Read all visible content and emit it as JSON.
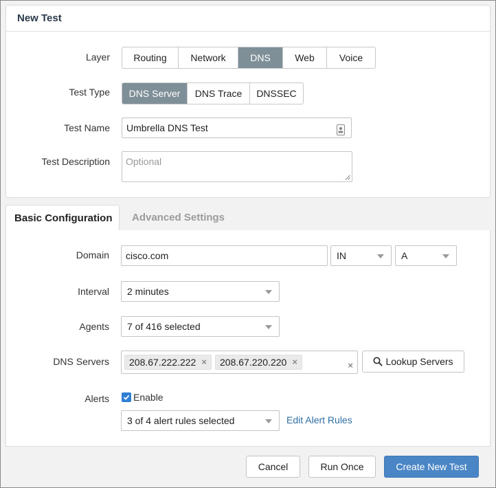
{
  "new_test": {
    "title": "New Test",
    "layer": {
      "label": "Layer",
      "options": [
        "Routing",
        "Network",
        "DNS",
        "Web",
        "Voice"
      ],
      "selected": "DNS"
    },
    "test_type": {
      "label": "Test Type",
      "options": [
        "DNS Server",
        "DNS Trace",
        "DNSSEC"
      ],
      "selected": "DNS Server"
    },
    "test_name": {
      "label": "Test Name",
      "value": "Umbrella DNS Test",
      "icon": "contact-card-icon"
    },
    "test_description": {
      "label": "Test Description",
      "placeholder": "Optional"
    }
  },
  "tabs": {
    "basic": "Basic Configuration",
    "advanced": "Advanced Settings",
    "active": "basic"
  },
  "basic": {
    "domain": {
      "label": "Domain",
      "value": "cisco.com",
      "class_value": "IN",
      "record_value": "A"
    },
    "interval": {
      "label": "Interval",
      "value": "2 minutes"
    },
    "agents": {
      "label": "Agents",
      "value": "7 of 416 selected"
    },
    "dns_servers": {
      "label": "DNS Servers",
      "servers": [
        "208.67.222.222",
        "208.67.220.220"
      ],
      "remove_glyph": "×",
      "clear_glyph": "×",
      "lookup_label": "Lookup Servers",
      "lookup_icon": "search-icon"
    },
    "alerts": {
      "label": "Alerts",
      "enable_label": "Enable",
      "enabled": true,
      "rules_value": "3 of 4 alert rules selected",
      "edit_link": "Edit Alert Rules"
    }
  },
  "footer": {
    "cancel": "Cancel",
    "run_once": "Run Once",
    "create": "Create New Test"
  },
  "colors": {
    "accent": "#4a86c5",
    "segment_active": "#7f8f97",
    "link": "#2f6ea5",
    "checkbox": "#2f7fd4"
  }
}
